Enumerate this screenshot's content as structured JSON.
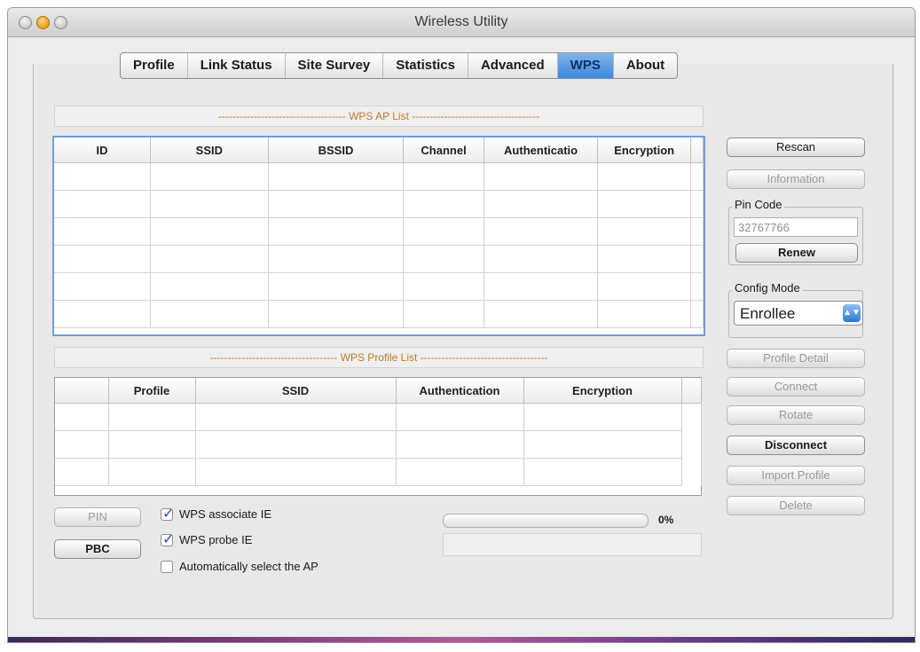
{
  "window": {
    "title": "Wireless Utility"
  },
  "tabs": [
    "Profile",
    "Link Status",
    "Site Survey",
    "Statistics",
    "Advanced",
    "WPS",
    "About"
  ],
  "active_tab": "WPS",
  "ap_list": {
    "header": "WPS AP List",
    "columns": [
      "ID",
      "SSID",
      "BSSID",
      "Channel",
      "Authenticatio",
      "Encryption"
    ]
  },
  "profile_list": {
    "header": "WPS Profile List",
    "columns": [
      "",
      "Profile",
      "SSID",
      "Authentication",
      "Encryption"
    ]
  },
  "buttons": {
    "rescan": "Rescan",
    "information": "Information",
    "renew": "Renew",
    "profile_detail": "Profile Detail",
    "connect": "Connect",
    "rotate": "Rotate",
    "disconnect": "Disconnect",
    "import_profile": "Import Profile",
    "delete": "Delete",
    "pin": "PIN",
    "pbc": "PBC"
  },
  "pin_code": {
    "label": "Pin Code",
    "value": "32767766"
  },
  "config_mode": {
    "label": "Config Mode",
    "value": "Enrollee"
  },
  "options": {
    "associate_ie": {
      "label": "WPS associate IE",
      "checked": true
    },
    "probe_ie": {
      "label": "WPS probe IE",
      "checked": true
    },
    "auto_select": {
      "label": "Automatically select the AP",
      "checked": false
    }
  },
  "progress": {
    "percent_label": "0%",
    "value": 0
  }
}
